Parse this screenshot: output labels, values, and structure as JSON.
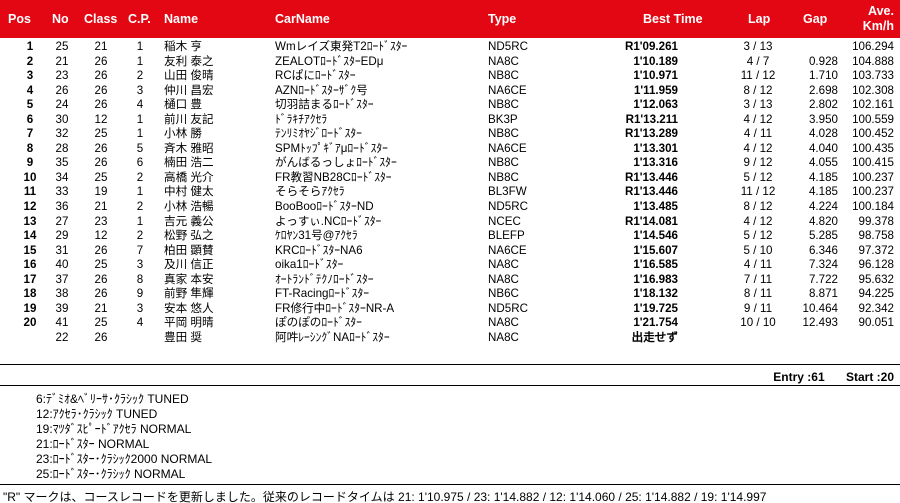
{
  "header": {
    "pos": "Pos",
    "no": "No",
    "class": "Class",
    "cp": "C.P.",
    "name": "Name",
    "carname": "CarName",
    "type": "Type",
    "best_time": "Best Time",
    "lap": "Lap",
    "gap": "Gap",
    "ave_top": "Ave.",
    "ave_bottom": "Km/h"
  },
  "rows": [
    {
      "pos": "1",
      "no": "25",
      "class": "21",
      "cp": "1",
      "name": "稲木 亨",
      "car": "Wmレイズ東発T2ﾛｰﾄﾞｽﾀｰ",
      "type": "ND5RC",
      "best": "R1'09.261",
      "lap": "3 / 13",
      "gap": "",
      "ave": "106.294"
    },
    {
      "pos": "2",
      "no": "21",
      "class": "26",
      "cp": "1",
      "name": "友利 泰之",
      "car": "ZEALOTﾛｰﾄﾞｽﾀｰEDμ",
      "type": "NA8C",
      "best": "1'10.189",
      "lap": "4 / 7",
      "gap": "0.928",
      "ave": "104.888"
    },
    {
      "pos": "3",
      "no": "23",
      "class": "26",
      "cp": "2",
      "name": "山田 俊晴",
      "car": "RCぱにﾛｰﾄﾞｽﾀｰ",
      "type": "NB8C",
      "best": "1'10.971",
      "lap": "11 / 12",
      "gap": "1.710",
      "ave": "103.733"
    },
    {
      "pos": "4",
      "no": "26",
      "class": "26",
      "cp": "3",
      "name": "仲川 昌宏",
      "car": "AZNﾛｰﾄﾞｽﾀｰｻﾞｸ号",
      "type": "NA6CE",
      "best": "1'11.959",
      "lap": "8 / 12",
      "gap": "2.698",
      "ave": "102.308"
    },
    {
      "pos": "5",
      "no": "24",
      "class": "26",
      "cp": "4",
      "name": "樋口 豊",
      "car": "切羽詰まるﾛｰﾄﾞｽﾀｰ",
      "type": "NB8C",
      "best": "1'12.063",
      "lap": "3 / 13",
      "gap": "2.802",
      "ave": "102.161"
    },
    {
      "pos": "6",
      "no": "30",
      "class": "12",
      "cp": "1",
      "name": "前川 友記",
      "car": "ﾄﾞﾗｷﾁｱｸｾﾗ",
      "type": "BK3P",
      "best": "R1'13.211",
      "lap": "4 / 12",
      "gap": "3.950",
      "ave": "100.559"
    },
    {
      "pos": "7",
      "no": "32",
      "class": "25",
      "cp": "1",
      "name": "小林 勝",
      "car": "ﾃﾝﾘﾐｵﾔｼﾞﾛｰﾄﾞｽﾀｰ",
      "type": "NB8C",
      "best": "R1'13.289",
      "lap": "4 / 11",
      "gap": "4.028",
      "ave": "100.452"
    },
    {
      "pos": "8",
      "no": "28",
      "class": "26",
      "cp": "5",
      "name": "斉木 雅昭",
      "car": "SPMﾄｯﾌﾟｷﾞｱμﾛｰﾄﾞｽﾀｰ",
      "type": "NA6CE",
      "best": "1'13.301",
      "lap": "4 / 12",
      "gap": "4.040",
      "ave": "100.435"
    },
    {
      "pos": "9",
      "no": "35",
      "class": "26",
      "cp": "6",
      "name": "楠田 浩二",
      "car": "がんばるっしょﾛｰﾄﾞｽﾀｰ",
      "type": "NB8C",
      "best": "1'13.316",
      "lap": "9 / 12",
      "gap": "4.055",
      "ave": "100.415"
    },
    {
      "pos": "10",
      "no": "34",
      "class": "25",
      "cp": "2",
      "name": "高橋 光介",
      "car": "FR教習NB28Cﾛｰﾄﾞｽﾀｰ",
      "type": "NB8C",
      "best": "R1'13.446",
      "lap": "5 / 12",
      "gap": "4.185",
      "ave": "100.237"
    },
    {
      "pos": "11",
      "no": "33",
      "class": "19",
      "cp": "1",
      "name": "中村 健太",
      "car": "そらそらｱｸｾﾗ",
      "type": "BL3FW",
      "best": "R1'13.446",
      "lap": "11 / 12",
      "gap": "4.185",
      "ave": "100.237"
    },
    {
      "pos": "12",
      "no": "36",
      "class": "21",
      "cp": "2",
      "name": "小林 浩暢",
      "car": "BooBooﾛｰﾄﾞｽﾀｰND",
      "type": "ND5RC",
      "best": "1'13.485",
      "lap": "8 / 12",
      "gap": "4.224",
      "ave": "100.184"
    },
    {
      "pos": "13",
      "no": "27",
      "class": "23",
      "cp": "1",
      "name": "吉元 義公",
      "car": "よっすぃ.NCﾛｰﾄﾞｽﾀｰ",
      "type": "NCEC",
      "best": "R1'14.081",
      "lap": "4 / 12",
      "gap": "4.820",
      "ave": "99.378"
    },
    {
      "pos": "14",
      "no": "29",
      "class": "12",
      "cp": "2",
      "name": "松野 弘之",
      "car": "ｹﾛﾔﾝ31号@ｱｸｾﾗ",
      "type": "BLEFP",
      "best": "1'14.546",
      "lap": "5 / 12",
      "gap": "5.285",
      "ave": "98.758"
    },
    {
      "pos": "15",
      "no": "31",
      "class": "26",
      "cp": "7",
      "name": "柏田 顕賛",
      "car": "KRCﾛｰﾄﾞｽﾀｰNA6",
      "type": "NA6CE",
      "best": "1'15.607",
      "lap": "5 / 10",
      "gap": "6.346",
      "ave": "97.372"
    },
    {
      "pos": "16",
      "no": "40",
      "class": "25",
      "cp": "3",
      "name": "及川 信正",
      "car": "oika1ﾛｰﾄﾞｽﾀｰ",
      "type": "NA8C",
      "best": "1'16.585",
      "lap": "4 / 11",
      "gap": "7.324",
      "ave": "96.128"
    },
    {
      "pos": "17",
      "no": "37",
      "class": "26",
      "cp": "8",
      "name": "真家 本安",
      "car": "ｵｰﾄﾗﾝﾄﾞﾃｸﾉﾛｰﾄﾞｽﾀｰ",
      "type": "NA8C",
      "best": "1'16.983",
      "lap": "7 / 11",
      "gap": "7.722",
      "ave": "95.632"
    },
    {
      "pos": "18",
      "no": "38",
      "class": "26",
      "cp": "9",
      "name": "前野 隼輝",
      "car": "FT-Racingﾛｰﾄﾞｽﾀｰ",
      "type": "NB6C",
      "best": "1'18.132",
      "lap": "8 / 11",
      "gap": "8.871",
      "ave": "94.225"
    },
    {
      "pos": "19",
      "no": "39",
      "class": "21",
      "cp": "3",
      "name": "安本 悠人",
      "car": "FR修行中ﾛｰﾄﾞｽﾀｰNR-A",
      "type": "ND5RC",
      "best": "1'19.725",
      "lap": "9 / 11",
      "gap": "10.464",
      "ave": "92.342"
    },
    {
      "pos": "20",
      "no": "41",
      "class": "25",
      "cp": "4",
      "name": "平岡 明晴",
      "car": "ぽのぽのﾛｰﾄﾞｽﾀｰ",
      "type": "NA8C",
      "best": "1'21.754",
      "lap": "10 / 10",
      "gap": "12.493",
      "ave": "90.051"
    },
    {
      "pos": "",
      "no": "22",
      "class": "26",
      "cp": "",
      "name": "豊田 奨",
      "car": "阿吽ﾚｰｼﾝｸﾞNAﾛｰﾄﾞｽﾀｰ",
      "type": "NA8C",
      "best": "出走せず",
      "lap": "",
      "gap": "",
      "ave": ""
    }
  ],
  "summary": {
    "entry": "Entry :61",
    "start": "Start :20"
  },
  "class_notes": [
    "6:ﾃﾞﾐｵ&ﾍﾞﾘｰｻ･ｸﾗｼｯｸ TUNED",
    "12:ｱｸｾﾗ･ｸﾗｼｯｸ TUNED",
    "19:ﾏﾂﾀﾞｽﾋﾟｰﾄﾞｱｸｾﾗ NORMAL",
    "21:ﾛｰﾄﾞｽﾀｰ NORMAL",
    "23:ﾛｰﾄﾞｽﾀｰ･ｸﾗｼｯｸ2000 NORMAL",
    "25:ﾛｰﾄﾞｽﾀｰ･ｸﾗｼｯｸ NORMAL"
  ],
  "footer": "\"R\" マークは、コースレコードを更新しました。従来のレコードタイムは 21: 1'10.975 / 23: 1'14.882 / 12: 1'14.060 / 25: 1'14.882 / 19: 1'14.997"
}
